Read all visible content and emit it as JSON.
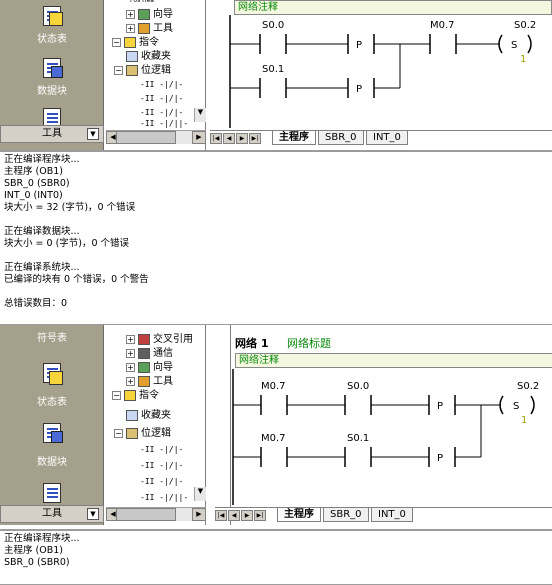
{
  "top": {
    "nav_items": [
      {
        "label": "状态表",
        "icon": "status-table-icon"
      },
      {
        "label": "数据块",
        "icon": "data-block-icon"
      }
    ],
    "tools_label": "工具",
    "tree": {
      "partial_top": "Pos Hea",
      "items": [
        {
          "label": "向导",
          "icon": "wizard-icon"
        },
        {
          "label": "工具",
          "icon": "tools-icon"
        },
        {
          "label": "指令",
          "icon": "instructions-icon"
        },
        {
          "label": "收藏夹",
          "icon": "favorites-icon"
        },
        {
          "label": "位逻辑",
          "icon": "bit-logic-icon"
        }
      ],
      "sub_items": [
        "-II -|/|-",
        "-II -|/|-",
        "-II -|/|-",
        "-II -|/||-"
      ]
    },
    "net_comment": "网络注释",
    "ladder": {
      "row1": [
        "S0.0",
        "P",
        "M0.7",
        "S0.2",
        "S",
        "1"
      ],
      "row2": [
        "S0.1",
        "P"
      ]
    },
    "tabs": [
      "主程序",
      "SBR_0",
      "INT_0"
    ]
  },
  "output1": {
    "lines": [
      "正在编译程序块...",
      "主程序 (OB1)",
      "SBR_0 (SBR0)",
      "INT_0 (INT0)",
      "块大小 = 32 (字节)，0 个错误",
      "",
      "正在编译数据块...",
      "块大小 = 0 (字节)，0 个错误",
      "",
      "正在编译系统块...",
      "已编译的块有 0 个错误，0 个警告",
      "",
      "总错误数目：0"
    ]
  },
  "bottom": {
    "nav_items": [
      {
        "label": "符号表",
        "icon": "symbol-table-icon"
      },
      {
        "label": "状态表",
        "icon": "status-table-icon"
      },
      {
        "label": "数据块",
        "icon": "data-block-icon"
      }
    ],
    "tools_label": "工具",
    "tree": {
      "items": [
        {
          "label": "交叉引用",
          "icon": "cross-ref-icon"
        },
        {
          "label": "通信",
          "icon": "comm-icon"
        },
        {
          "label": "向导",
          "icon": "wizard-icon"
        },
        {
          "label": "工具",
          "icon": "tools-icon"
        },
        {
          "label": "指令",
          "icon": "instructions-icon"
        },
        {
          "label": "收藏夹",
          "icon": "favorites-icon"
        },
        {
          "label": "位逻辑",
          "icon": "bit-logic-icon"
        }
      ],
      "sub_items": [
        "-II -|/|-",
        "-II -|/|-",
        "-II -|/|-",
        "-II -|/||-"
      ]
    },
    "net_label": "网络 1",
    "net_title": "网络标题",
    "net_comment": "网络注释",
    "ladder": {
      "row1": [
        "M0.7",
        "S0.0",
        "P",
        "S0.2",
        "S",
        "1"
      ],
      "row2": [
        "M0.7",
        "S0.1",
        "P"
      ]
    },
    "tabs": [
      "主程序",
      "SBR_0",
      "INT_0"
    ]
  },
  "output2": {
    "lines": [
      "正在编译程序块...",
      "主程序 (OB1)",
      "SBR_0 (SBR0)"
    ]
  },
  "colors": {
    "nav_bg": "#a4a08c",
    "comment_text": "#0a8a0a",
    "coil_value": "#a0a000"
  }
}
